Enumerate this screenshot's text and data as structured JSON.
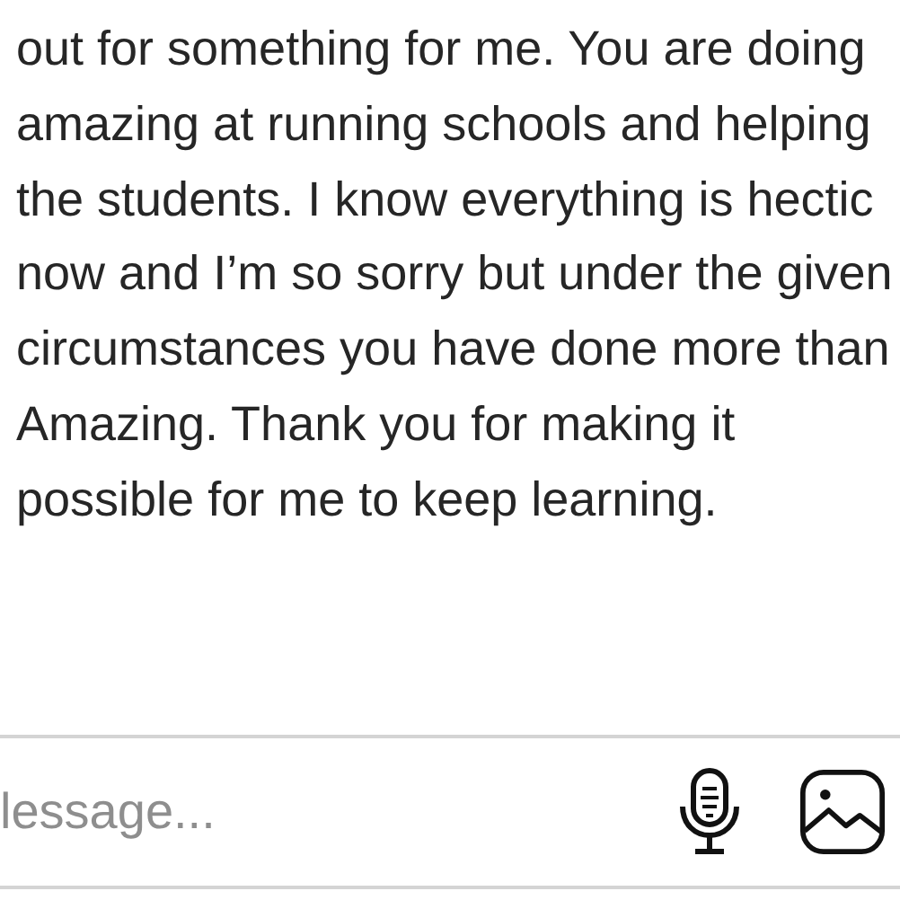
{
  "message": {
    "text": "out for something for me. You are doing amazing at running schools and helping the students. I know everything is hectic now and I’m so sorry but under the given circumstances you have done more than Amazing. Thank you for making it possible for me to keep learning."
  },
  "composer": {
    "placeholder": "lessage..."
  }
}
